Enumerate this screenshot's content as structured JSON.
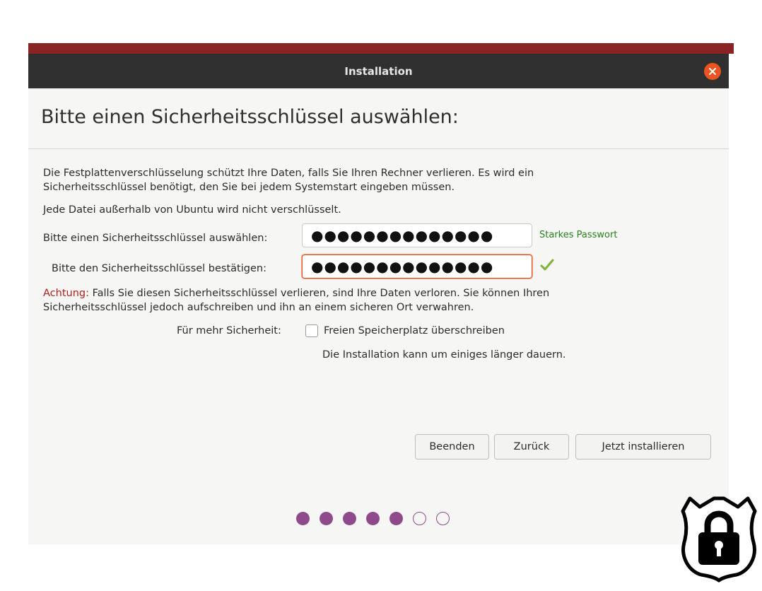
{
  "window": {
    "title": "Installation",
    "heading": "Bitte einen Sicherheitsschlüssel auswählen:"
  },
  "content": {
    "description_line1": "Die Festplattenverschlüsselung schützt Ihre Daten, falls Sie Ihren Rechner verlieren. Es wird ein",
    "description_line2": "Sicherheitsschlüssel benötigt, den Sie bei jedem Systemstart eingeben müssen.",
    "note": "Jede Datei außerhalb von Ubuntu wird nicht verschlüsselt.",
    "key_label": "Bitte einen Sicherheitsschlüssel auswählen:",
    "key_value": "●●●●●●●●●●●●●●",
    "strength": "Starkes Passwort",
    "confirm_label": "Bitte den Sicherheitsschlüssel bestätigen:",
    "confirm_value": "●●●●●●●●●●●●●●",
    "warning_word": "Achtung:",
    "warning_rest": " Falls Sie diesen Sicherheitsschlüssel verlieren, sind Ihre Daten verloren. Sie können Ihren",
    "warning_line2": "Sicherheitsschlüssel jedoch aufschreiben und ihn an einem sicheren Ort verwahren.",
    "security_label": "Für mehr Sicherheit:",
    "overwrite_label": "Freien Speicherplatz überschreiben",
    "overwrite_hint": "Die Installation kann um einiges länger dauern."
  },
  "buttons": {
    "quit": "Beenden",
    "back": "Zurück",
    "install": "Jetzt installieren"
  },
  "progress": {
    "total_steps": 7,
    "current_step": 5
  },
  "colors": {
    "accent": "#e95420",
    "dots": "#8e4a8b",
    "titlebar": "#303030",
    "strength": "#2a7f1f",
    "warning": "#b0201a"
  }
}
